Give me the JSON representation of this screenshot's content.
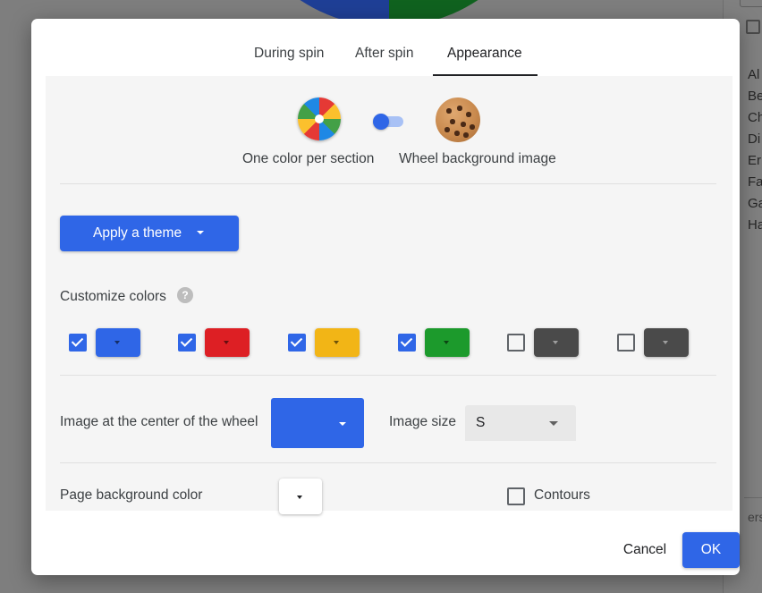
{
  "tabs": [
    {
      "label": "During spin"
    },
    {
      "label": "After spin"
    },
    {
      "label": "Appearance",
      "active": true
    }
  ],
  "appearance_mode": {
    "left_label": "One color per section",
    "right_label": "Wheel background image",
    "selected": "One color per section"
  },
  "theme": {
    "label": "Apply a theme"
  },
  "customize": {
    "label": "Customize colors",
    "help_icon": "?"
  },
  "color_slots": [
    {
      "checked": true,
      "color": "#2f66e7"
    },
    {
      "checked": true,
      "color": "#dd1f24"
    },
    {
      "checked": true,
      "color": "#f2b516"
    },
    {
      "checked": true,
      "color": "#1c9a2c"
    },
    {
      "checked": false,
      "color": "#4a4a4a"
    },
    {
      "checked": false,
      "color": "#4a4a4a"
    }
  ],
  "center_image": {
    "label": "Image at the center of the wheel",
    "color": "#2f66e7"
  },
  "image_size": {
    "label": "Image size",
    "value": "S"
  },
  "page_background": {
    "label": "Page background color",
    "color": "#ffffff"
  },
  "contours": {
    "label": "Contours",
    "checked": false
  },
  "footer": {
    "cancel_label": "Cancel",
    "ok_label": "OK"
  },
  "background_page": {
    "list_items": [
      "Al",
      "Be",
      "Ch",
      "Di",
      "Er",
      "Fa",
      "Ga",
      "Ha"
    ],
    "footer_text": "ers"
  },
  "colors": {
    "accent": "#2f66e7"
  }
}
